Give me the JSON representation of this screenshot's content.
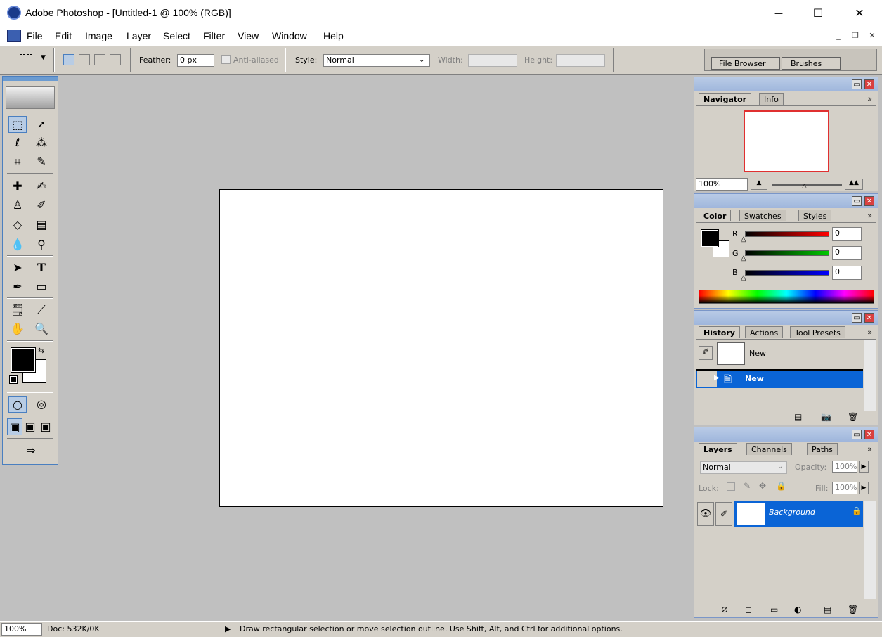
{
  "window": {
    "title": "Adobe Photoshop - [Untitled-1 @ 100% (RGB)]",
    "min_glyph": "—",
    "max_glyph": "☐",
    "close_glyph": "✕"
  },
  "menu": [
    "File",
    "Edit",
    "Image",
    "Layer",
    "Select",
    "Filter",
    "View",
    "Window",
    "Help"
  ],
  "mdi_controls": {
    "min": "_",
    "restore": "❐",
    "close": "✕"
  },
  "options": {
    "feather_label": "Feather:",
    "feather_value": "0 px",
    "anti_aliased_label": "Anti-aliased",
    "style_label": "Style:",
    "style_value": "Normal",
    "width_label": "Width:",
    "height_label": "Height:",
    "well_tabs": [
      "File Browser",
      "Brushes"
    ]
  },
  "navigator": {
    "tabs": [
      "Navigator",
      "Info"
    ],
    "zoom": "100%",
    "proxy_color": "#e03030"
  },
  "color": {
    "tabs": [
      "Color",
      "Swatches",
      "Styles"
    ],
    "channels": [
      {
        "label": "R",
        "value": "0",
        "color": "#ff0000"
      },
      {
        "label": "G",
        "value": "0",
        "color": "#00c800"
      },
      {
        "label": "B",
        "value": "0",
        "color": "#0000ff"
      }
    ]
  },
  "history": {
    "tabs": [
      "History",
      "Actions",
      "Tool Presets"
    ],
    "snapshot_label": "New",
    "state_label": "New",
    "selected_color": "#0a64d6"
  },
  "layers": {
    "tabs": [
      "Layers",
      "Channels",
      "Paths"
    ],
    "blend_mode": "Normal",
    "opacity_label": "Opacity:",
    "opacity_value": "100%",
    "lock_label": "Lock:",
    "fill_label": "Fill:",
    "fill_value": "100%",
    "layer_name": "Background"
  },
  "status": {
    "zoom": "100%",
    "doc": "Doc: 532K/0K",
    "hint": "Draw rectangular selection or move selection outline.  Use Shift, Alt, and Ctrl for additional options."
  }
}
